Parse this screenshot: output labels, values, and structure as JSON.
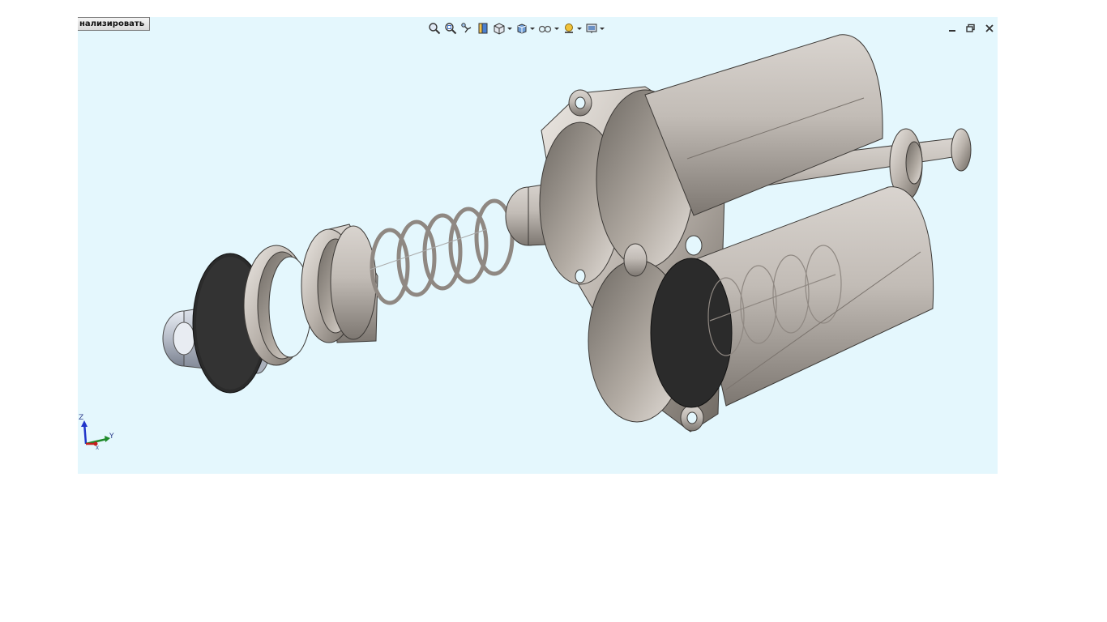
{
  "viewport": {
    "tab_label": "нализировать",
    "background": "#e4f7fd"
  },
  "toolbar": {
    "icons": [
      "zoom-to-fit-icon",
      "zoom-to-area-icon",
      "previous-view-icon",
      "section-view-icon",
      "view-orientation-icon",
      "display-style-icon",
      "hide-show-items-icon",
      "edit-appearance-icon",
      "apply-scene-icon"
    ]
  },
  "triad": {
    "x_label": "X",
    "y_label": "Y",
    "z_label": "Z"
  }
}
